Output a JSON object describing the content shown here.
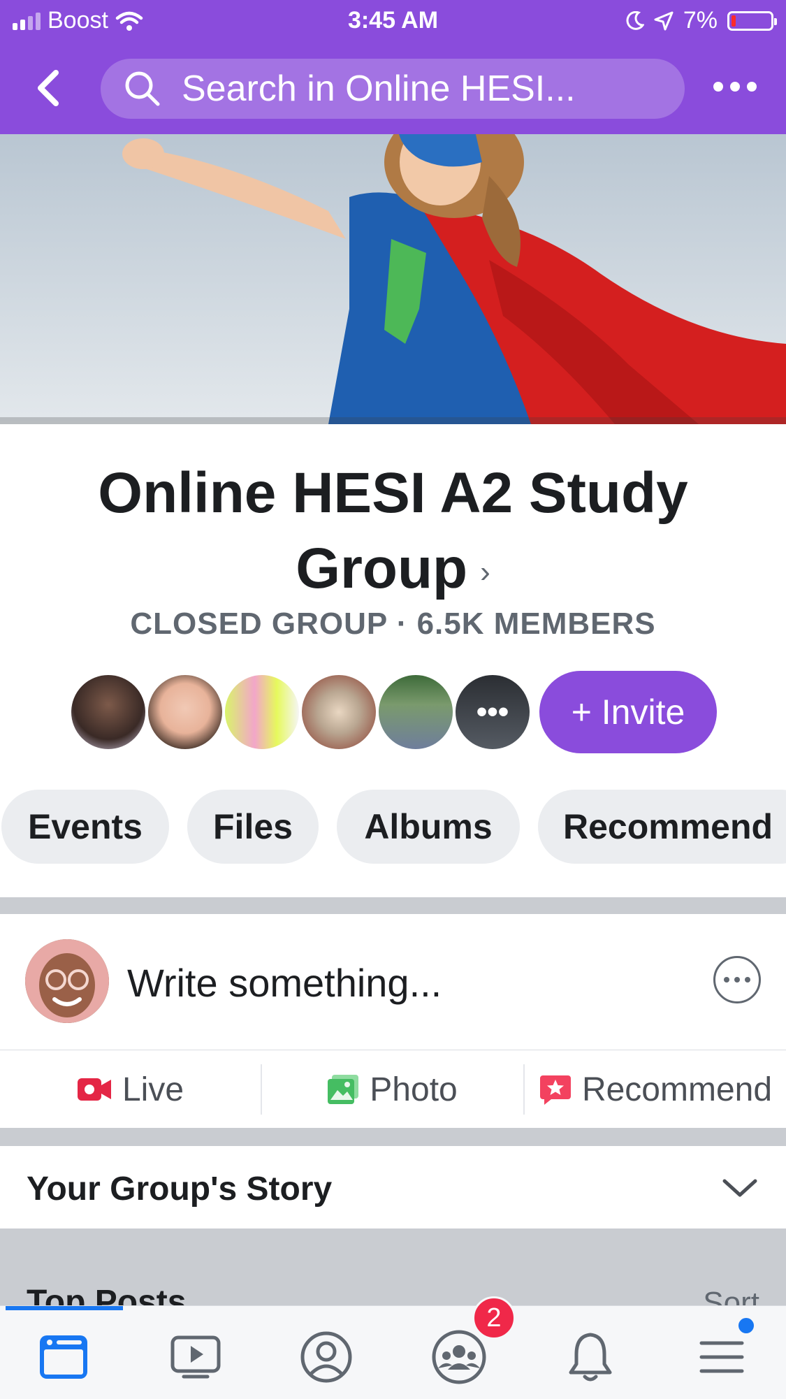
{
  "status_bar": {
    "carrier": "Boost",
    "time": "3:45 AM",
    "battery": "7%"
  },
  "nav": {
    "search_placeholder": "Search in Online HESI..."
  },
  "group": {
    "name_line1": "Online HESI A2 Study",
    "name_line2": "Group",
    "meta": "CLOSED GROUP · 6.5K MEMBERS",
    "invite_label": "+ Invite"
  },
  "chips": [
    "Events",
    "Files",
    "Albums",
    "Recommend"
  ],
  "composer": {
    "prompt": "Write something...",
    "actions": [
      "Live",
      "Photo",
      "Recommend"
    ]
  },
  "story": {
    "label": "Your Group's Story"
  },
  "top_posts": {
    "label": "Top Posts",
    "sort": "Sort"
  },
  "tabbar": {
    "groups_badge": "2"
  },
  "colors": {
    "brand_purple": "#8a4cdc",
    "tab_active_blue": "#1877f2",
    "badge_red": "#f02849",
    "live_red": "#e42645",
    "photo_green": "#45bd62",
    "recommend_pink": "#f3425f"
  }
}
